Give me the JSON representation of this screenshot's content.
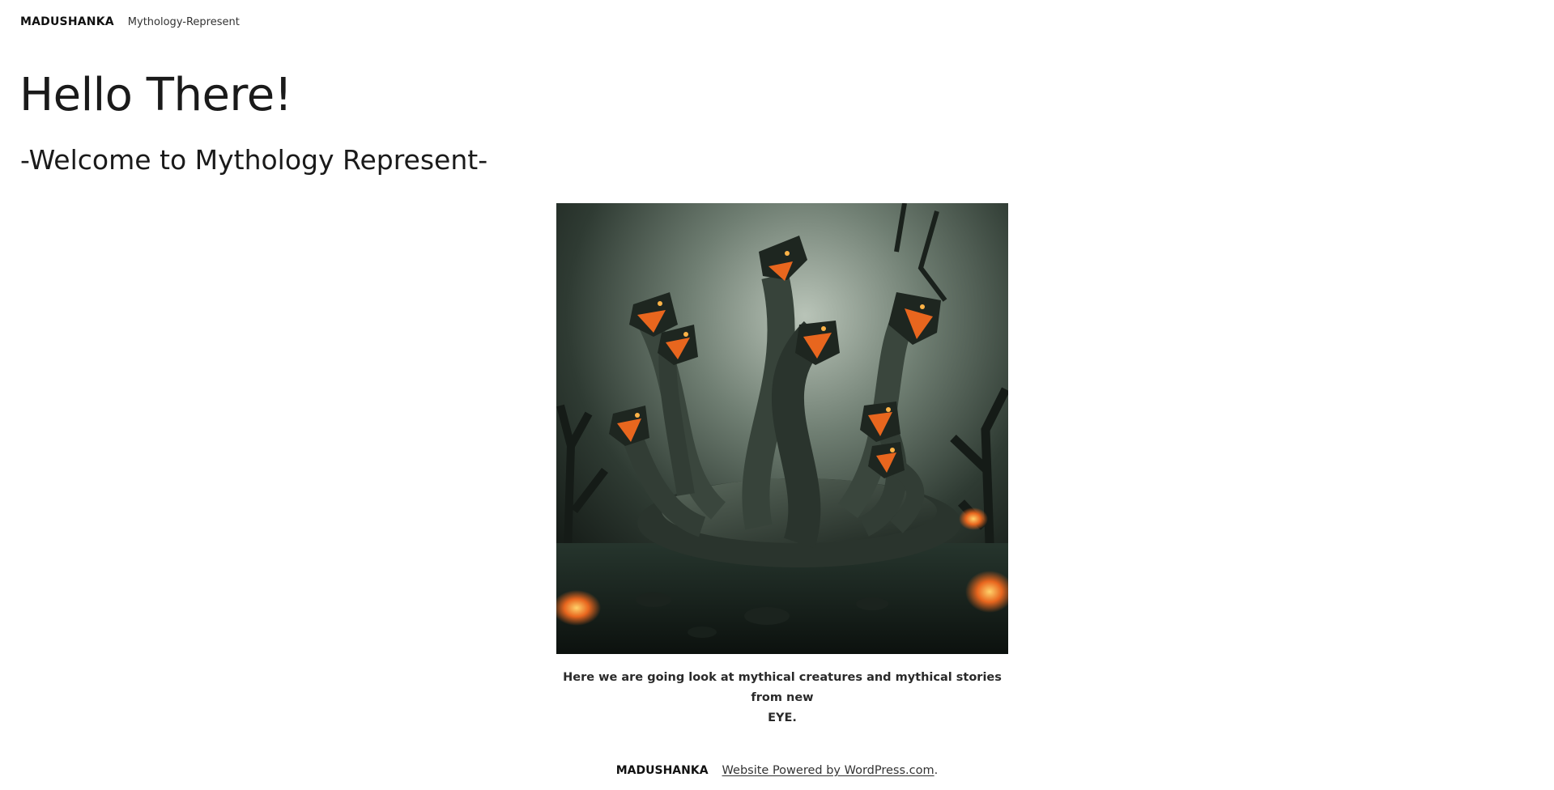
{
  "header": {
    "site_title": "MADUSHANKA",
    "tagline": "Mythology-Represent"
  },
  "main": {
    "title": "Hello There!",
    "subtitle": "-Welcome to Mythology Represent-",
    "figure": {
      "image_icon": "hydra-illustration",
      "caption_line1": "Here we are going look at mythical creatures and mythical stories from new",
      "caption_line2": "EYE."
    }
  },
  "footer": {
    "site_title": "MADUSHANKA",
    "powered_by": "Website Powered by WordPress.com",
    "period": "."
  },
  "colors": {
    "background": "#ffffff",
    "text": "#1a1a1a",
    "image_dark": "#1c241f",
    "image_mist": "#9aa89d",
    "image_fire": "#e8661e"
  }
}
